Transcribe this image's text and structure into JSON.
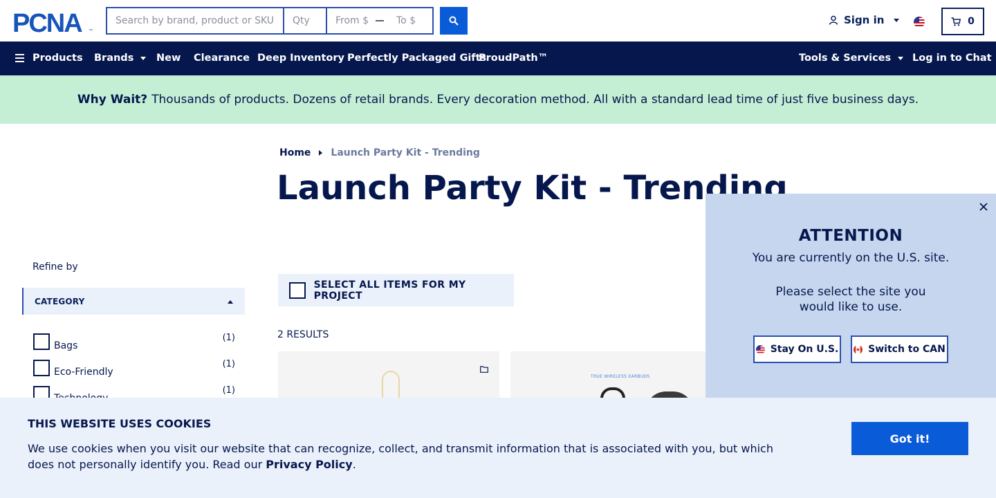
{
  "header": {
    "logo_text": "PCNA",
    "search_placeholder": "Search by brand, product or SKU",
    "qty_placeholder": "Qty",
    "from_placeholder": "From $",
    "to_placeholder": "To $",
    "signin_label": "Sign in",
    "cart_count": "0"
  },
  "nav": {
    "products": "Products",
    "brands": "Brands",
    "new": "New",
    "clearance": "Clearance",
    "deep_inventory": "Deep Inventory",
    "gifts": "Perfectly Packaged Gifts",
    "proudpath": "ProudPath™",
    "tools": "Tools & Services",
    "chat": "Log in to Chat"
  },
  "banner": {
    "lead": "Why Wait?",
    "text": "Thousands of products. Dozens of retail brands. Every decoration method. All with a standard lead time of just five business days."
  },
  "breadcrumb": {
    "home": "Home",
    "current": "Launch Party Kit - Trending"
  },
  "page": {
    "title": "Launch Party Kit - Trending"
  },
  "sidebar": {
    "refine": "Refine by",
    "category_header": "CATEGORY",
    "categories": [
      {
        "label": "Bags",
        "count": "(1)"
      },
      {
        "label": "Eco-Friendly",
        "count": "(1)"
      },
      {
        "label": "Technology",
        "count": "(1)"
      }
    ]
  },
  "results": {
    "select_all": "SELECT ALL ITEMS FOR MY PROJECT",
    "count": "2 RESULTS",
    "card2_label": "TRUE WIRELESS EARBUDS"
  },
  "attention": {
    "title": "ATTENTION",
    "line1": "You are currently on the U.S. site.",
    "line2": "Please select the site you",
    "line3": "would like to use.",
    "stay": "Stay On U.S.",
    "switch": "Switch to CAN"
  },
  "cookies": {
    "title": "THIS WEBSITE USES COOKIES",
    "text": "We use cookies when you visit our website that can recognize, collect, and transmit information that is associated with you, but which does not personally identify you. Read our",
    "link": "Privacy Policy",
    "end": ".",
    "button": "Got it!"
  },
  "colors": {
    "navy": "#06174d",
    "blue": "#0a5bd8",
    "banner_green": "#c4efd4",
    "modal_blue": "#c5d6ee",
    "light_blue": "#eaf1fb"
  }
}
